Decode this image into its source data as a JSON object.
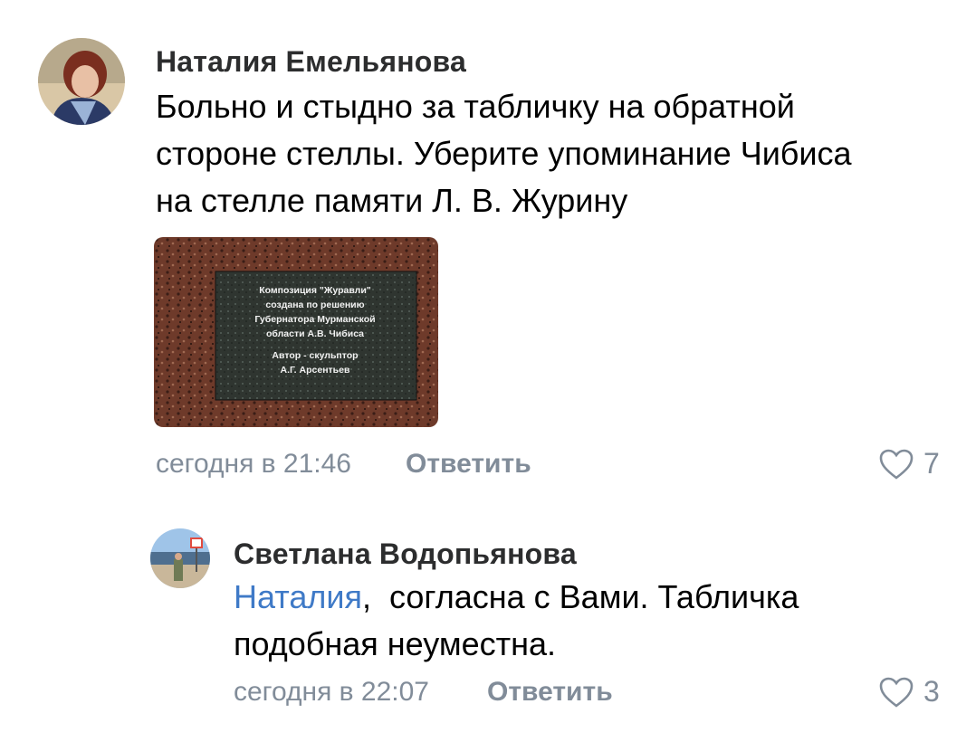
{
  "comments": [
    {
      "author": "Наталия Емельянова",
      "lines": [
        "Больно и стыдно за табличку на обратной",
        "стороне стеллы. Уберите упоминание Чибиса",
        "на стелле  памяти Л. В. Журину"
      ],
      "attachment": {
        "plaque_lines": [
          "Композиция \"Журавли\"",
          "создана по решению",
          "Губернатора Мурманской",
          "области А.В. Чибиса",
          "Автор - скульптор",
          "А.Г. Арсентьев"
        ]
      },
      "time": "сегодня в 21:46",
      "reply_label": "Ответить",
      "likes": "7"
    },
    {
      "author": "Светлана Водопьянова",
      "mention": "Наталия",
      "first_line_rest": ",  согласна с Вами. Табличка",
      "second_line": "подобная неуместна.",
      "time": "сегодня в 22:07",
      "reply_label": "Ответить",
      "likes": "3"
    }
  ],
  "colors": {
    "secondary_text": "#818c99",
    "mention": "#3f7ac7",
    "author": "#2c2d2e"
  },
  "icons": [
    "avatar",
    "photo-attachment",
    "heart-icon"
  ]
}
